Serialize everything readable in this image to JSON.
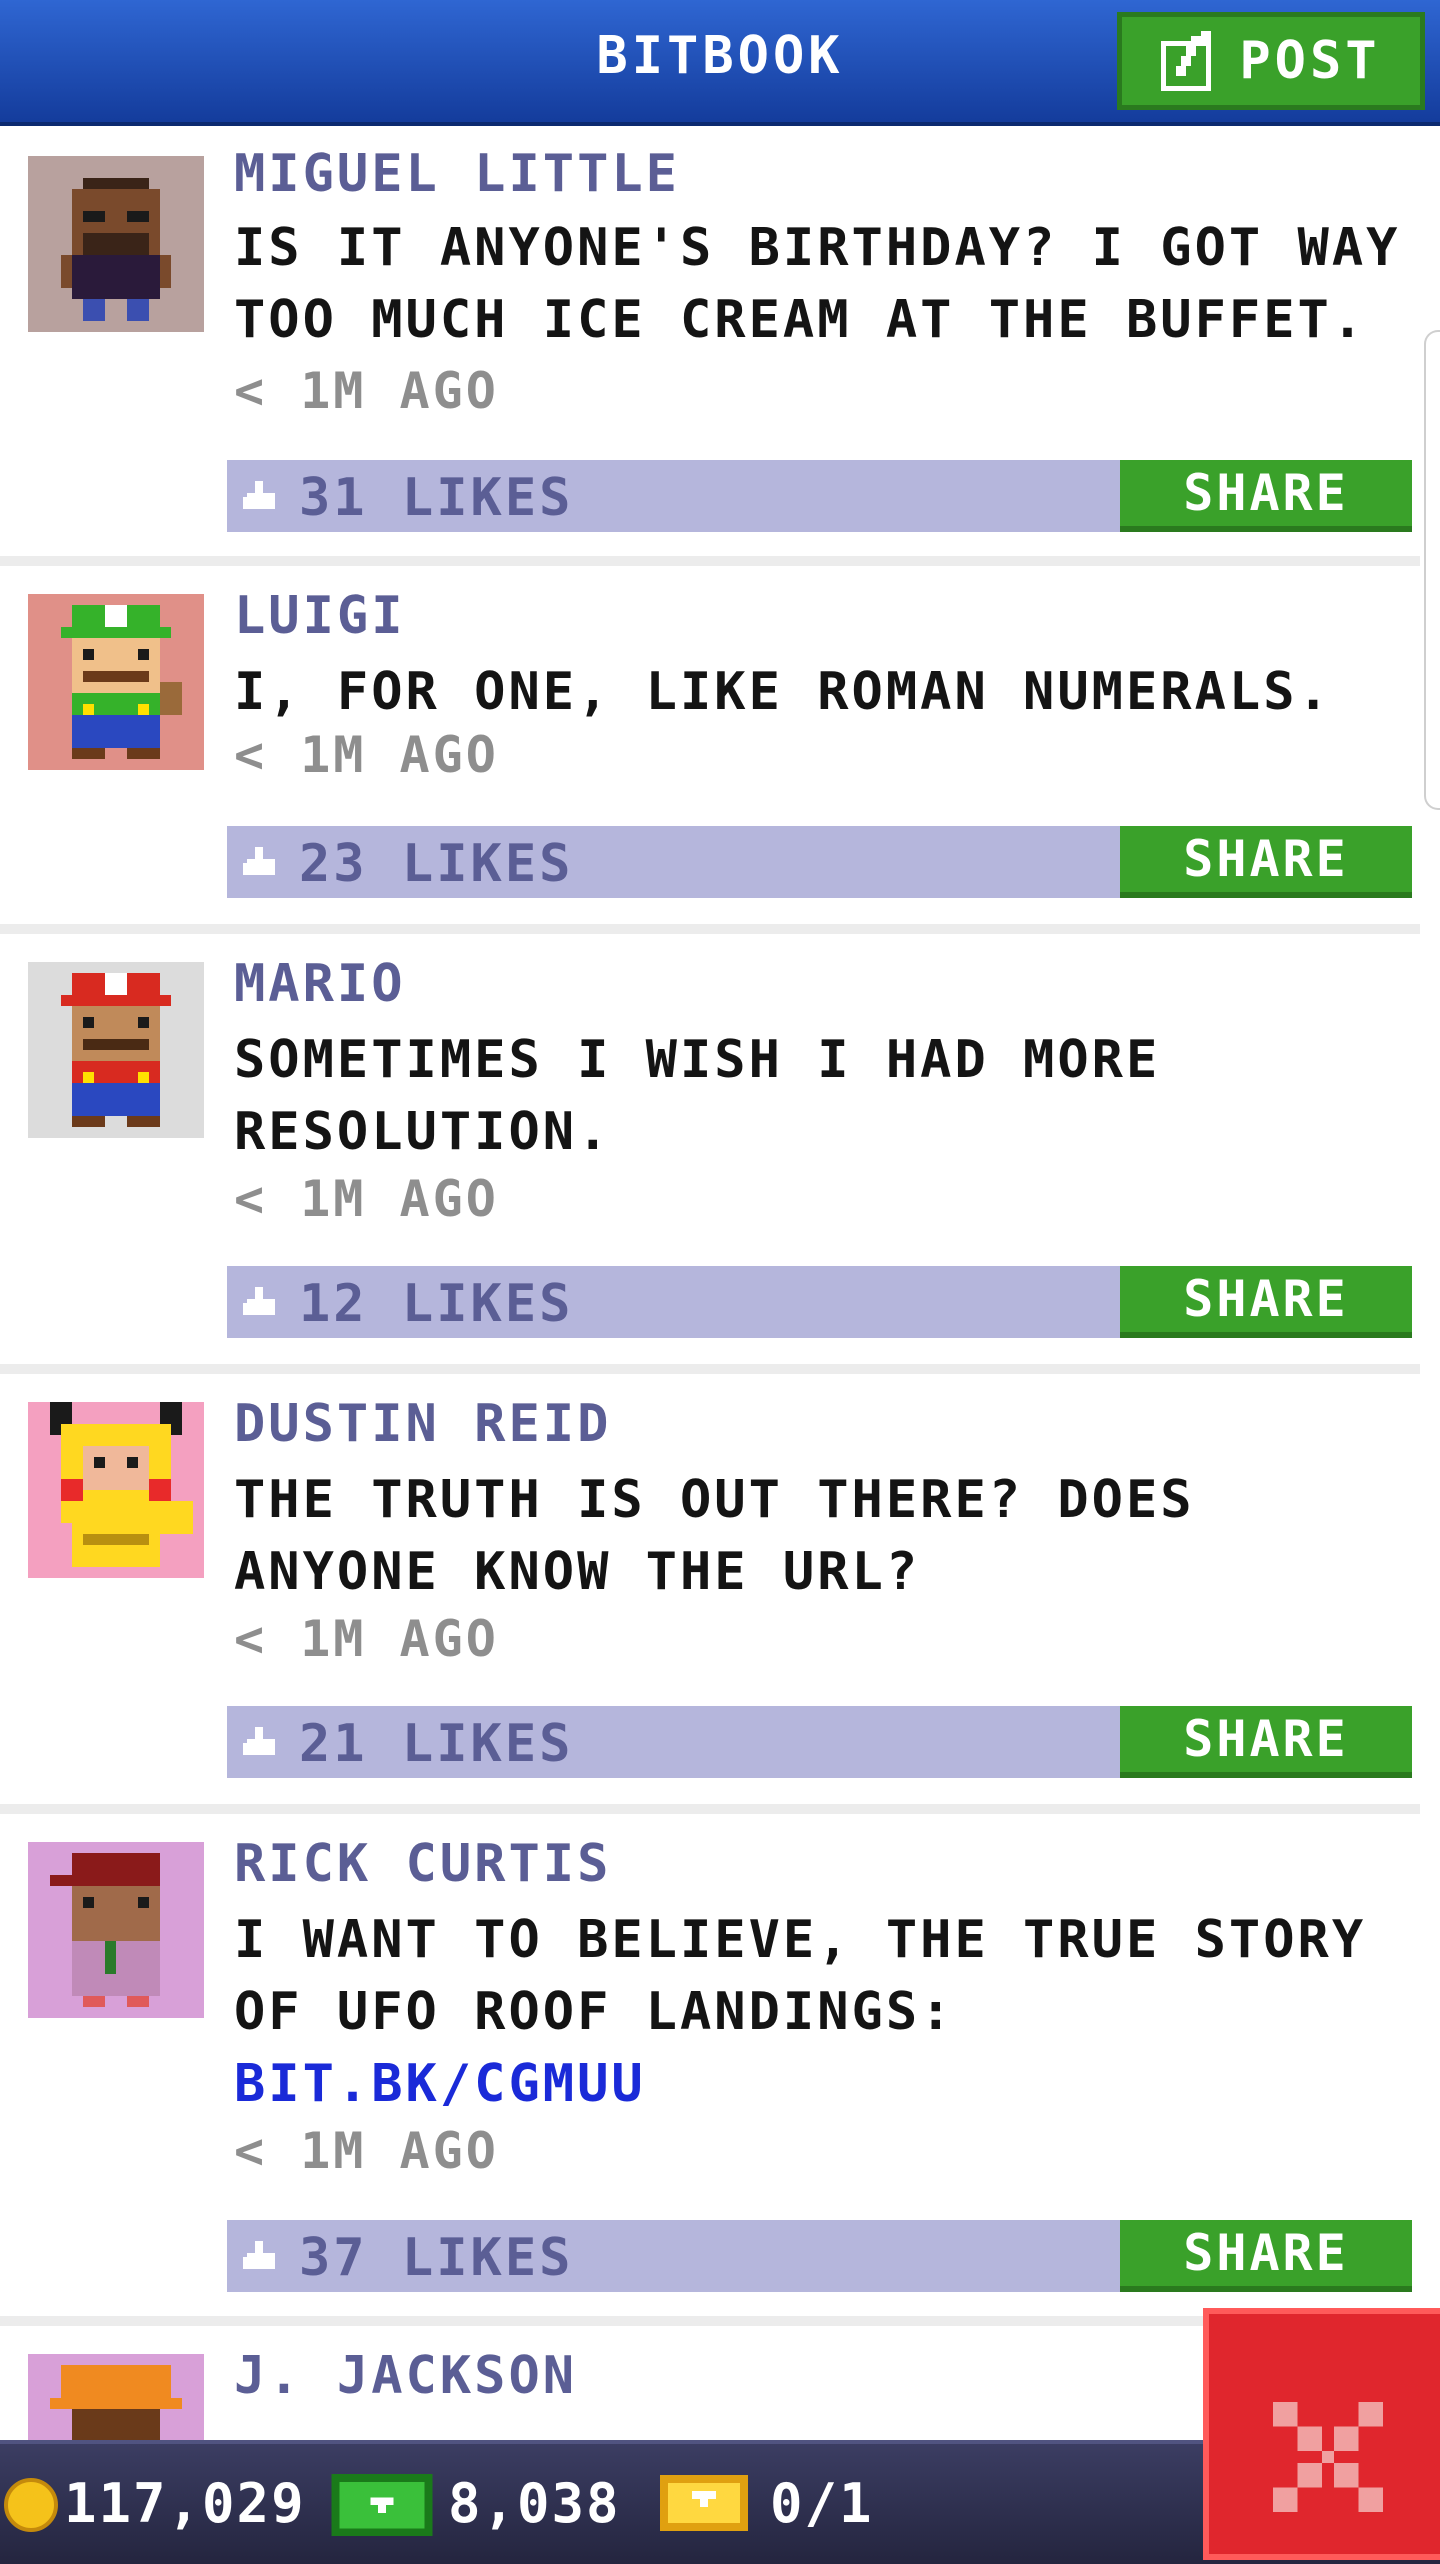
{
  "header": {
    "title": "BITBOOK",
    "post_label": "POST"
  },
  "posts": [
    {
      "author": "MIGUEL LITTLE",
      "text": "IS IT ANYONE'S BIRTHDAY? I GOT WAY TOO MUCH ICE CREAM AT THE BUFFET.",
      "time": "< 1M AGO",
      "likes": "31 LIKES",
      "share": "SHARE",
      "avatar": "miguel-avatar"
    },
    {
      "author": "LUIGI",
      "text": "I, FOR ONE, LIKE ROMAN NUMERALS.",
      "time": "< 1M AGO",
      "likes": "23 LIKES",
      "share": "SHARE",
      "avatar": "luigi-avatar"
    },
    {
      "author": "MARIO",
      "text": "SOMETIMES I WISH I HAD MORE RESOLUTION.",
      "time": "< 1M AGO",
      "likes": "12 LIKES",
      "share": "SHARE",
      "avatar": "mario-avatar"
    },
    {
      "author": "DUSTIN REID",
      "text": "THE TRUTH IS OUT THERE? DOES ANYONE KNOW THE URL?",
      "time": "< 1M AGO",
      "likes": "21 LIKES",
      "share": "SHARE",
      "avatar": "pikachu-costume-avatar"
    },
    {
      "author": "RICK CURTIS",
      "text": "I WANT TO BELIEVE, THE TRUE STORY OF UFO ROOF LANDINGS:",
      "link": "BIT.BK/CGMUU",
      "time": "< 1M AGO",
      "likes": "37 LIKES",
      "share": "SHARE",
      "avatar": "rick-avatar"
    },
    {
      "author": "J. JACKSON",
      "avatar": "jackson-avatar"
    }
  ],
  "status": {
    "coins": "117,029",
    "bux": "8,038",
    "tickets": "0/1"
  },
  "colors": {
    "header": "#1f4fbf",
    "green_button": "#3aa12a",
    "likes_bar": "#b5b6dc",
    "author": "#5b5e95",
    "link": "#1a2ad8",
    "close": "#e0262d"
  },
  "icons": [
    "post-edit-icon",
    "like-icon",
    "coin-icon",
    "cash-icon",
    "ticket-icon",
    "close-icon"
  ]
}
